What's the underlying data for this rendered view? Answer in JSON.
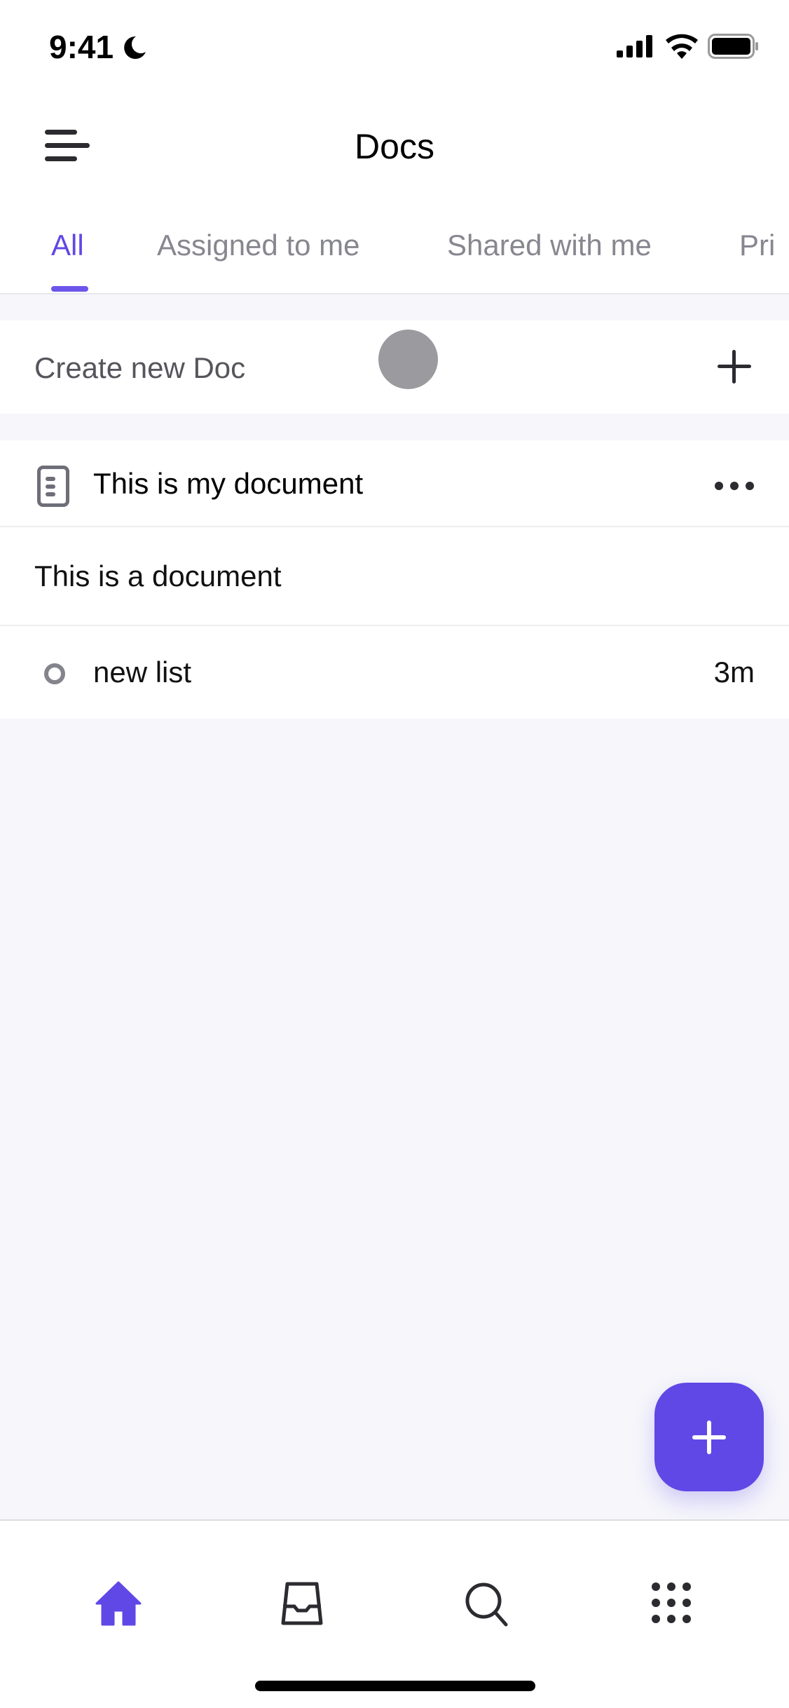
{
  "status_bar": {
    "time": "9:41"
  },
  "header": {
    "title": "Docs"
  },
  "tabs": [
    {
      "label": "All",
      "active": true
    },
    {
      "label": "Assigned to me"
    },
    {
      "label": "Shared with me"
    },
    {
      "label": "Pri"
    }
  ],
  "create_row": {
    "label": "Create new Doc"
  },
  "document": {
    "title": "This is my document",
    "content": "This is a document",
    "list_item": {
      "label": "new list",
      "time": "3m"
    }
  },
  "bottom_nav": [
    "home-icon",
    "inbox-icon",
    "search-icon",
    "apps-grid-icon"
  ],
  "colors": {
    "accent": "#6048e6",
    "background": "#f6f6fb"
  }
}
